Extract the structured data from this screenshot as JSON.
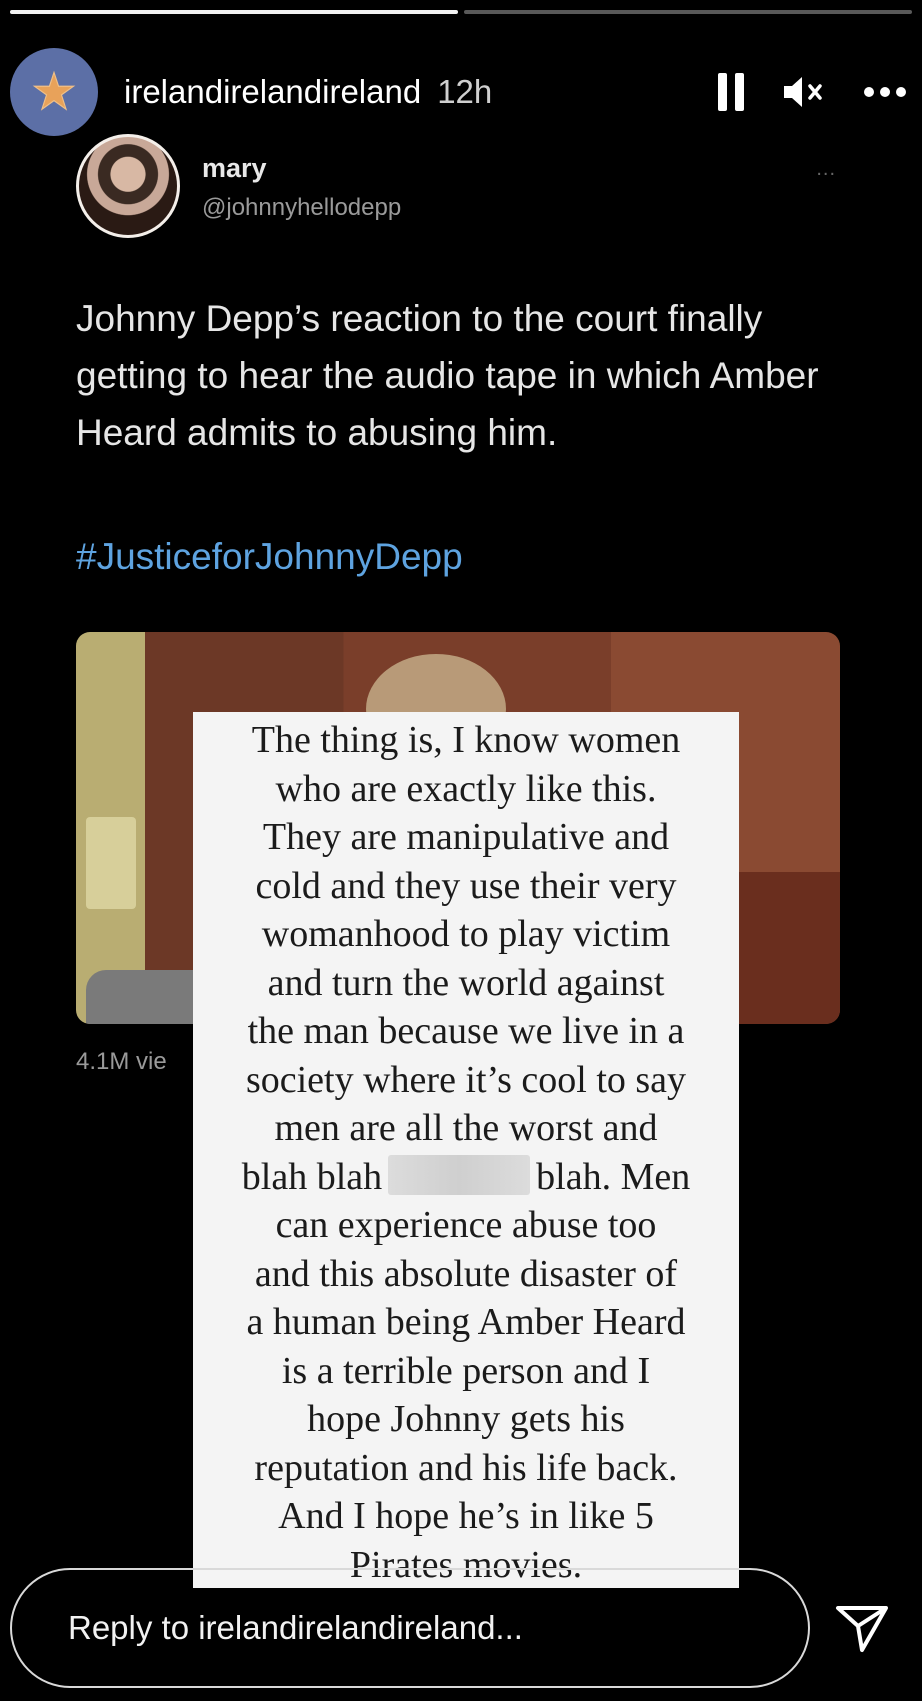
{
  "story": {
    "progress": [
      1,
      0
    ],
    "account": "irelandirelandireland",
    "time": "12h",
    "icons": [
      "starfish-icon",
      "pause-icon",
      "mute-icon",
      "more-icon"
    ]
  },
  "tweet": {
    "name": "mary",
    "handle": "@johnnyhellodepp",
    "more": "...",
    "text": "Johnny Depp’s reaction to the court finally getting to hear the audio tape in which Amber Heard admits to abusing him.",
    "hashtag": "#JusticeforJohnnyDepp",
    "views": "4.1M vie"
  },
  "overlay": {
    "lines": [
      "The thing is, I know women",
      "who are exactly like this.",
      "They are manipulative and",
      "cold and they use their very",
      "womanhood to play victim",
      "and turn the world against",
      "the man because we live in a",
      "society where it’s cool to say",
      "men are all the worst and"
    ],
    "blah_before": "blah blah",
    "blah_after": "blah. Men",
    "lines_after": [
      "can experience abuse too",
      "and this absolute disaster of",
      "a human being Amber Heard",
      "is a terrible person and I",
      "hope Johnny gets his",
      "reputation and his life back.",
      "And I hope he’s in like 5",
      "Pirates movies."
    ]
  },
  "reply": {
    "placeholder": "Reply to irelandirelandireland..."
  }
}
